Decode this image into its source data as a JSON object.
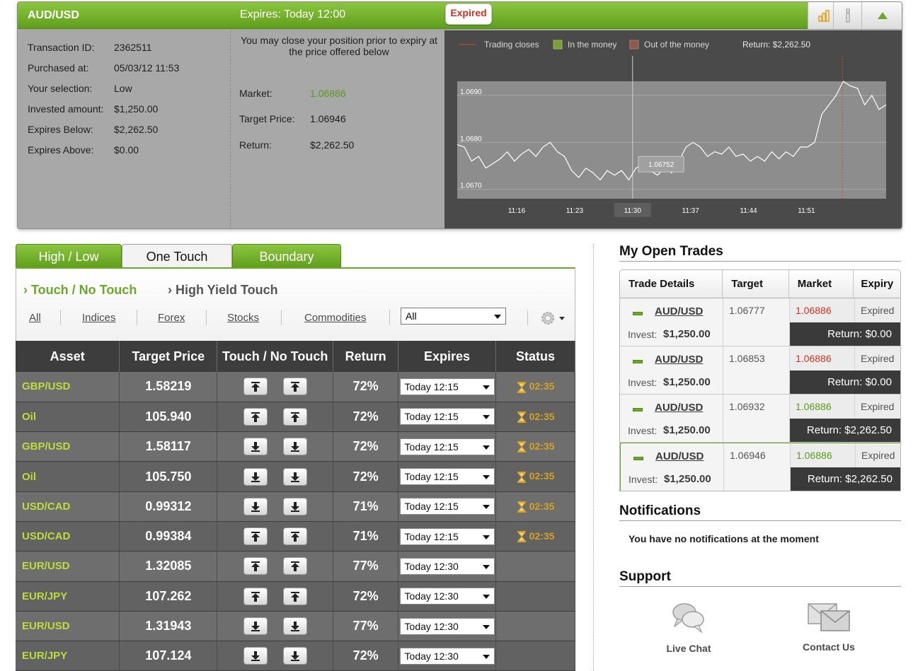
{
  "colors": {
    "brand_green": "#6aa82a",
    "asset_yellow_green": "#bedc3c",
    "market_green": "#5a9a1a",
    "market_red": "#cc3322",
    "status_gold": "#d4a31f",
    "expired_red": "#cc3322"
  },
  "top_panel": {
    "asset": "AUD/USD",
    "expires": "Expires:  Today 12:00",
    "badge": "Expired",
    "icons": [
      "bar-chart-icon",
      "info-icon",
      "collapse-arrow-icon"
    ],
    "details": [
      {
        "label": "Transaction ID:",
        "value": "2362511"
      },
      {
        "label": "Purchased at:",
        "value": "05/03/12 11:53"
      },
      {
        "label": "Your selection:",
        "value": "Low"
      },
      {
        "label": "Invested amount:",
        "value": "$1,250.00"
      },
      {
        "label": "Expires Below:",
        "value": "$2,262.50"
      },
      {
        "label": "Expires Above:",
        "value": "$0.00"
      }
    ],
    "close_message": "You may close your position prior to expiry at the price offered below",
    "market_label": "Market:",
    "market_value": "1.06886",
    "target_label": "Target Price:",
    "target_value": "1.06946",
    "return_label": "Return:",
    "return_value": "$2,262.50"
  },
  "chart_data": {
    "type": "line",
    "legend": [
      "Trading closes",
      "In the money",
      "Out of the money"
    ],
    "legend_return": "Return: $2,262.50",
    "x_ticks": [
      "11:16",
      "11:23",
      "11:30",
      "11:37",
      "11:44",
      "11:51"
    ],
    "y_ticks": [
      "1.0690",
      "1.0680",
      "1.0670"
    ],
    "ylim": [
      1.0668,
      1.0693
    ],
    "highlighted_x": "11:30",
    "hover_value": "1.06752",
    "series": [
      {
        "x": [
          0,
          1,
          2,
          3,
          4,
          5,
          6,
          7,
          8,
          9,
          10,
          11,
          12,
          13,
          14,
          15,
          16,
          17,
          18,
          19,
          20,
          21,
          22,
          23,
          24,
          25,
          26,
          27,
          28,
          29,
          30,
          31,
          32,
          33,
          34,
          35,
          36,
          37,
          38,
          39,
          40,
          41,
          42,
          43,
          44,
          45,
          46,
          47,
          48,
          49,
          50,
          51,
          52,
          53,
          54,
          55,
          56,
          57,
          58,
          59,
          60
        ],
        "values": [
          1.06795,
          1.0679,
          1.0676,
          1.0677,
          1.06745,
          1.06755,
          1.06765,
          1.0678,
          1.0676,
          1.06775,
          1.06785,
          1.0677,
          1.0679,
          1.068,
          1.0678,
          1.0677,
          1.0674,
          1.06725,
          1.06745,
          1.06735,
          1.0672,
          1.0674,
          1.0673,
          1.0674,
          1.0672,
          1.06745,
          1.06752,
          1.0674,
          1.0673,
          1.06745,
          1.06735,
          1.0676,
          1.0679,
          1.068,
          1.0679,
          1.0677,
          1.0678,
          1.06775,
          1.0679,
          1.0677,
          1.06775,
          1.0676,
          1.0677,
          1.0676,
          1.0678,
          1.06765,
          1.0678,
          1.0677,
          1.0679,
          1.0679,
          1.068,
          1.0686,
          1.0688,
          1.069,
          1.0693,
          1.0692,
          1.06915,
          1.0688,
          1.069,
          1.0687,
          1.0688
        ]
      }
    ]
  },
  "tabs": [
    {
      "label": "High / Low"
    },
    {
      "label": "One Touch"
    },
    {
      "label": "Boundary"
    }
  ],
  "subtabs": [
    {
      "label": "Touch / No Touch"
    },
    {
      "label": "High Yield Touch"
    }
  ],
  "filters": [
    {
      "label": "All"
    },
    {
      "label": "Indices"
    },
    {
      "label": "Forex"
    },
    {
      "label": "Stocks"
    },
    {
      "label": "Commodities"
    }
  ],
  "filter_select": "All",
  "table": {
    "headers": [
      "Asset",
      "Target Price",
      "Touch / No Touch",
      "Return",
      "Expires",
      "Status"
    ],
    "rows": [
      {
        "asset": "GBP/USD",
        "target": "1.58219",
        "direction": "up",
        "return": "72%",
        "expires": "Today 12:15",
        "status": "02:35"
      },
      {
        "asset": "Oil",
        "target": "105.940",
        "direction": "up",
        "return": "72%",
        "expires": "Today 12:15",
        "status": "02:35"
      },
      {
        "asset": "GBP/USD",
        "target": "1.58117",
        "direction": "down",
        "return": "72%",
        "expires": "Today 12:15",
        "status": "02:35"
      },
      {
        "asset": "Oil",
        "target": "105.750",
        "direction": "down",
        "return": "72%",
        "expires": "Today 12:15",
        "status": "02:35"
      },
      {
        "asset": "USD/CAD",
        "target": "0.99312",
        "direction": "down",
        "return": "71%",
        "expires": "Today 12:15",
        "status": "02:35"
      },
      {
        "asset": "USD/CAD",
        "target": "0.99384",
        "direction": "up",
        "return": "71%",
        "expires": "Today 12:15",
        "status": "02:35"
      },
      {
        "asset": "EUR/USD",
        "target": "1.32085",
        "direction": "up",
        "return": "77%",
        "expires": "Today 12:30",
        "status": ""
      },
      {
        "asset": "EUR/JPY",
        "target": "107.262",
        "direction": "up",
        "return": "72%",
        "expires": "Today 12:30",
        "status": ""
      },
      {
        "asset": "EUR/USD",
        "target": "1.31943",
        "direction": "down",
        "return": "77%",
        "expires": "Today 12:30",
        "status": ""
      },
      {
        "asset": "EUR/JPY",
        "target": "107.124",
        "direction": "down",
        "return": "72%",
        "expires": "Today 12:30",
        "status": ""
      }
    ]
  },
  "open_trades": {
    "title": "My Open Trades",
    "headers": [
      "Trade Details",
      "Target",
      "Market",
      "Expiry"
    ],
    "invest_label": "Invest:",
    "rows": [
      {
        "asset": "AUD/USD",
        "invest": "$1,250.00",
        "target": "1.06777",
        "market": "1.06886",
        "market_color": "red",
        "expiry": "Expired",
        "return": "Return: $0.00"
      },
      {
        "asset": "AUD/USD",
        "invest": "$1,250.00",
        "target": "1.06853",
        "market": "1.06886",
        "market_color": "red",
        "expiry": "Expired",
        "return": "Return: $0.00"
      },
      {
        "asset": "AUD/USD",
        "invest": "$1,250.00",
        "target": "1.06932",
        "market": "1.06886",
        "market_color": "green",
        "expiry": "Expired",
        "return": "Return: $2,262.50"
      },
      {
        "asset": "AUD/USD",
        "invest": "$1,250.00",
        "target": "1.06946",
        "market": "1.06886",
        "market_color": "green",
        "expiry": "Expired",
        "return": "Return: $2,262.50"
      }
    ]
  },
  "notifications": {
    "title": "Notifications",
    "message": "You have no notifications at the moment"
  },
  "support": {
    "title": "Support",
    "live_chat": "Live Chat",
    "contact_us": "Contact Us"
  }
}
